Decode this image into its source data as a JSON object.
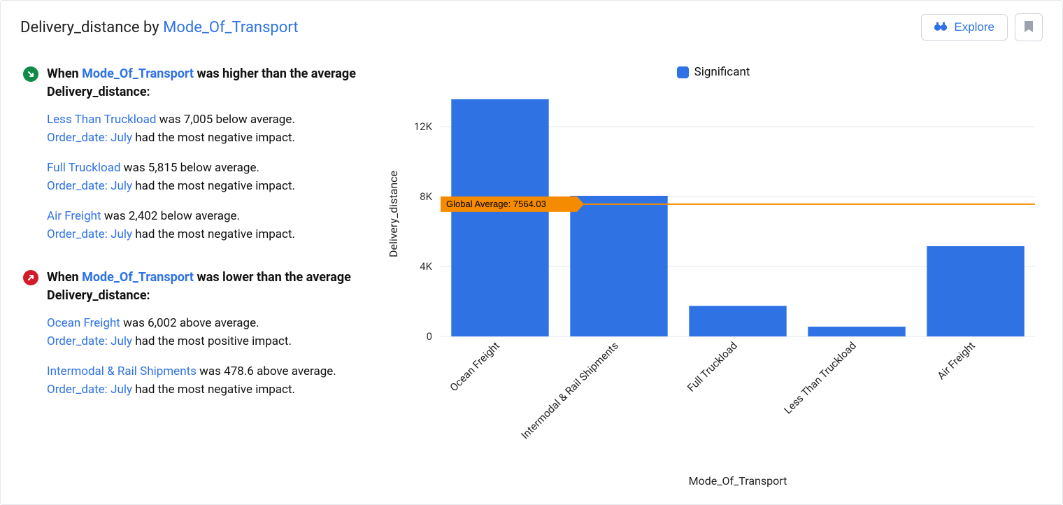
{
  "header": {
    "title_prefix": "Delivery_distance by ",
    "title_dimension": "Mode_Of_Transport",
    "explore_label": "Explore"
  },
  "insights": {
    "higher": {
      "lead_pre": "When ",
      "lead_link": "Mode_Of_Transport",
      "lead_post": " was higher than the average Delivery_distance:",
      "items": [
        {
          "line1_link": "Less Than Truckload",
          "line1_rest": " was 7,005 below average.",
          "line2_link": "Order_date: July",
          "line2_rest": " had the most negative impact."
        },
        {
          "line1_link": "Full Truckload",
          "line1_rest": " was 5,815 below average.",
          "line2_link": "Order_date: July",
          "line2_rest": " had the most negative impact."
        },
        {
          "line1_link": "Air Freight",
          "line1_rest": " was 2,402 below average.",
          "line2_link": "Order_date: July",
          "line2_rest": " had the most negative impact."
        }
      ]
    },
    "lower": {
      "lead_pre": "When ",
      "lead_link": "Mode_Of_Transport",
      "lead_post": " was lower than the average Delivery_distance:",
      "items": [
        {
          "line1_link": "Ocean Freight",
          "line1_rest": " was 6,002 above average.",
          "line2_link": "Order_date: July",
          "line2_rest": " had the most positive impact."
        },
        {
          "line1_link": "Intermodal & Rail Shipments",
          "line1_rest": " was 478.6 above average.",
          "line2_link": "Order_date: July",
          "line2_rest": " had the most negative impact."
        }
      ]
    }
  },
  "legend": {
    "label": "Significant",
    "color": "#2f72e4"
  },
  "chart_data": {
    "type": "bar",
    "title": "",
    "xlabel": "Mode_Of_Transport",
    "ylabel": "Delivery_distance",
    "ylim": [
      0,
      14000
    ],
    "y_ticks": [
      0,
      4000,
      8000,
      12000
    ],
    "y_tick_labels": [
      "0",
      "4K",
      "8K",
      "12K"
    ],
    "grid": true,
    "categories": [
      "Ocean Freight",
      "Intermodal & Rail Shipments",
      "Full Truckload",
      "Less Than Truckload",
      "Air Freight"
    ],
    "values": [
      13566,
      8043,
      1749,
      559,
      5162
    ],
    "series_name": "Significant",
    "bar_color": "#2f72e4",
    "reference_lines": [
      {
        "label": "Global Average: 7564.03",
        "value": 7564.03,
        "color": "#f58b00"
      }
    ]
  }
}
